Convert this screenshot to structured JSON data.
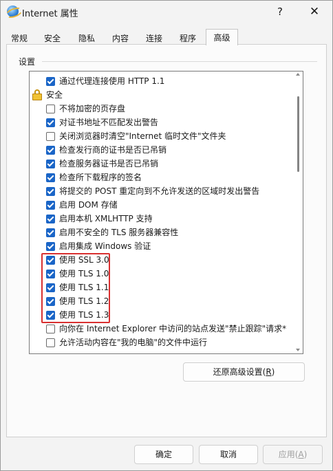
{
  "window": {
    "title": "Internet 属性",
    "help_glyph": "?",
    "close_glyph": "✕"
  },
  "tabs": [
    {
      "label": "常规"
    },
    {
      "label": "安全"
    },
    {
      "label": "隐私"
    },
    {
      "label": "内容"
    },
    {
      "label": "连接"
    },
    {
      "label": "程序"
    },
    {
      "label": "高级",
      "selected": true
    }
  ],
  "settings": {
    "group_label": "设置",
    "items": [
      {
        "type": "checkbox",
        "label": "通过代理连接使用 HTTP 1.1",
        "checked": true
      },
      {
        "type": "category",
        "label": "安全",
        "icon": "lock-icon"
      },
      {
        "type": "checkbox",
        "label": "不将加密的页存盘",
        "checked": false
      },
      {
        "type": "checkbox",
        "label": "对证书地址不匹配发出警告",
        "checked": true
      },
      {
        "type": "checkbox",
        "label": "关闭浏览器时清空\"Internet 临时文件\"文件夹",
        "checked": false
      },
      {
        "type": "checkbox",
        "label": "检查发行商的证书是否已吊销",
        "checked": true
      },
      {
        "type": "checkbox",
        "label": "检查服务器证书是否已吊销",
        "checked": true
      },
      {
        "type": "checkbox",
        "label": "检查所下载程序的签名",
        "checked": true
      },
      {
        "type": "checkbox",
        "label": "将提交的 POST 重定向到不允许发送的区域时发出警告",
        "checked": true
      },
      {
        "type": "checkbox",
        "label": "启用 DOM 存储",
        "checked": true
      },
      {
        "type": "checkbox",
        "label": "启用本机 XMLHTTP 支持",
        "checked": true
      },
      {
        "type": "checkbox",
        "label": "启用不安全的 TLS 服务器兼容性",
        "checked": true
      },
      {
        "type": "checkbox",
        "label": "启用集成 Windows 验证",
        "checked": true
      },
      {
        "type": "checkbox",
        "label": "使用 SSL 3.0",
        "checked": true
      },
      {
        "type": "checkbox",
        "label": "使用 TLS 1.0",
        "checked": true
      },
      {
        "type": "checkbox",
        "label": "使用 TLS 1.1",
        "checked": true
      },
      {
        "type": "checkbox",
        "label": "使用 TLS 1.2",
        "checked": true
      },
      {
        "type": "checkbox",
        "label": "使用 TLS 1.3",
        "checked": true
      },
      {
        "type": "checkbox",
        "label": "向你在 Internet Explorer 中访问的站点发送\"禁止跟踪\"请求*",
        "checked": false
      },
      {
        "type": "checkbox",
        "label": "允许活动内容在\"我的电脑\"的文件中运行",
        "checked": false
      }
    ]
  },
  "buttons": {
    "restore": {
      "label": "还原高级设置(",
      "key": "R",
      "suffix": ")"
    },
    "ok": "确定",
    "cancel": "取消",
    "apply": {
      "label": "应用(",
      "key": "A",
      "suffix": ")",
      "enabled": false
    }
  },
  "colors": {
    "checkbox_on": "#1a65c7",
    "highlight_border": "#d93030"
  }
}
